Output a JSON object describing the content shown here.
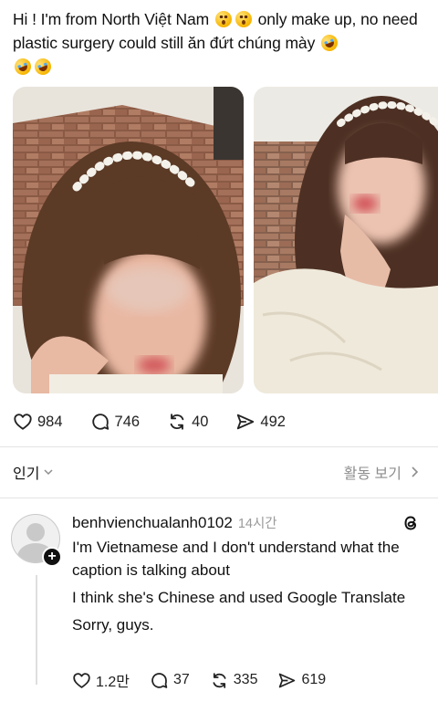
{
  "post": {
    "caption_part1": "Hi ! I'm from North Việt Nam ",
    "caption_part2": " only make up, no need plastic surgery could still ăn đứt chúng mày ",
    "emojis": [
      "hushed-face-icon",
      "hushed-face-icon",
      "rolling-on-floor-laughing-icon",
      "rolling-on-floor-laughing-icon",
      "rolling-on-floor-laughing-icon"
    ],
    "stats": {
      "likes": "984",
      "replies": "746",
      "reposts": "40",
      "shares": "492"
    }
  },
  "sort": {
    "label": "인기",
    "activity_label": "활동 보기"
  },
  "comment": {
    "username": "benhvienchualanh0102",
    "time": "14시간",
    "lines": [
      "I'm Vietnamese and I don't understand what the caption is talking about",
      "I think she's Chinese and used Google Translate",
      "Sorry, guys."
    ],
    "stats": {
      "likes": "1.2만",
      "replies": "37",
      "reposts": "335",
      "shares": "619"
    }
  },
  "colors": {
    "text": "#111111",
    "muted": "#8e8e8e",
    "divider": "#e4e4e4",
    "badge": "#111111"
  }
}
